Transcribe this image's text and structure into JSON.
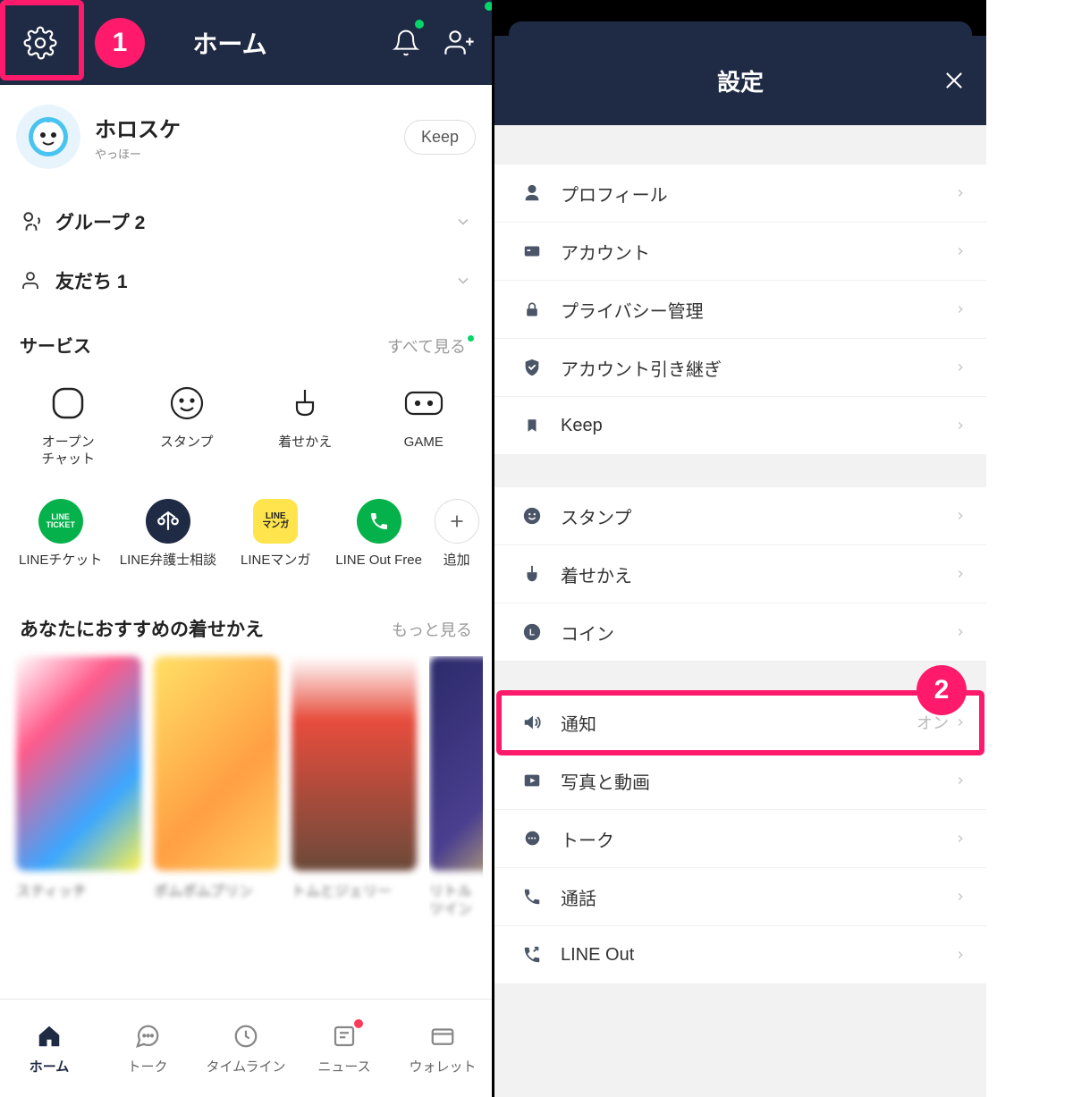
{
  "left": {
    "header": {
      "title": "ホーム"
    },
    "profile": {
      "name": "ホロスケ",
      "status": "やっほー",
      "keep": "Keep"
    },
    "groups_label": "グループ 2",
    "friends_label": "友だち 1",
    "services_title": "サービス",
    "services_more": "すべて見る",
    "services1": [
      {
        "label": "オープン\nチャット"
      },
      {
        "label": "スタンプ"
      },
      {
        "label": "着せかえ"
      },
      {
        "label": "GAME"
      }
    ],
    "services2": [
      {
        "label": "LINEチケット"
      },
      {
        "label": "LINE弁護士相談"
      },
      {
        "label": "LINEマンガ"
      },
      {
        "label": "LINE Out Free"
      },
      {
        "label": "追加"
      }
    ],
    "rec_title": "あなたにおすすめの着せかえ",
    "rec_more": "もっと見る",
    "themes": [
      {
        "caption": "スティッチ"
      },
      {
        "caption": "ポムポムプリン"
      },
      {
        "caption": "トムとジェリー"
      },
      {
        "caption": "リトルツイン"
      }
    ],
    "tabs": [
      {
        "label": "ホーム"
      },
      {
        "label": "トーク"
      },
      {
        "label": "タイムライン"
      },
      {
        "label": "ニュース"
      },
      {
        "label": "ウォレット"
      }
    ]
  },
  "right": {
    "title": "設定",
    "section1": [
      {
        "label": "プロフィール"
      },
      {
        "label": "アカウント"
      },
      {
        "label": "プライバシー管理"
      },
      {
        "label": "アカウント引き継ぎ"
      },
      {
        "label": "Keep"
      }
    ],
    "section2": [
      {
        "label": "スタンプ"
      },
      {
        "label": "着せかえ"
      },
      {
        "label": "コイン"
      }
    ],
    "section3": [
      {
        "label": "通知",
        "value": "オン"
      },
      {
        "label": "写真と動画"
      },
      {
        "label": "トーク"
      },
      {
        "label": "通話"
      },
      {
        "label": "LINE Out"
      }
    ]
  },
  "annotations": {
    "one": "1",
    "two": "2"
  }
}
